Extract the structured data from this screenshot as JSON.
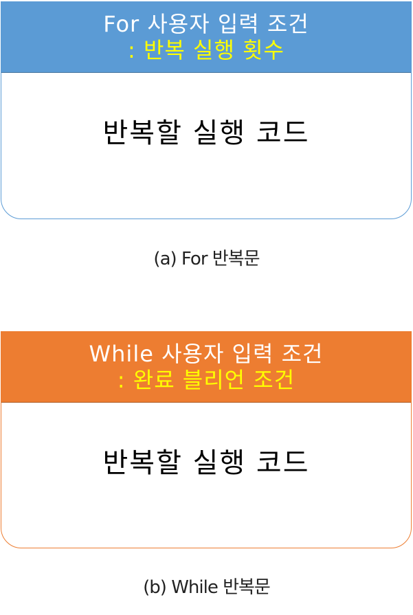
{
  "for_block": {
    "header_line1": "For 사용자 입력 조건",
    "header_line2": ": 반복 실행 횟수",
    "body": "반복할 실행 코드",
    "caption": "(a) For 반복문"
  },
  "while_block": {
    "header_line1": "While 사용자 입력 조건",
    "header_line2": ": 완료 블리언 조건",
    "body": "반복할 실행 코드",
    "caption": "(b) While 반복문"
  },
  "colors": {
    "for_header": "#5b9bd5",
    "while_header": "#ed7d31",
    "header_text": "#ffffff",
    "condition_text": "#ffff00",
    "body_text": "#000000"
  }
}
